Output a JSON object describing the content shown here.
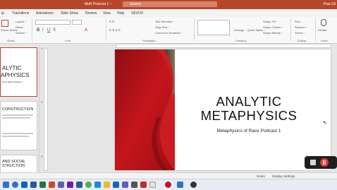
{
  "titlebar": {
    "doc_title": "MoR Podcast 1 ~",
    "search_placeholder": "Search",
    "user": "Paul Gil"
  },
  "tabs": [
    "ip",
    "Transitions",
    "Animations",
    "Slide Show",
    "Review",
    "View",
    "Help",
    "VEVOX"
  ],
  "ribbon": {
    "groups": [
      "Slides",
      "Font",
      "Paragraph",
      "Drawing",
      "Editing",
      "Voice"
    ],
    "slides_buttons": [
      "Reuse Slides",
      "Layout ~",
      "Reset",
      "Section ~"
    ],
    "paragraph_buttons": [
      "Text Direction ~",
      "Align Text ~",
      "Convert to SmartArt ~"
    ],
    "drawing_buttons": [
      "Arrange",
      "Quick Styles ~",
      "Shape Fill ~",
      "Shape Outline ~",
      "Shape Effects ~"
    ],
    "editing_buttons": [
      "Find",
      "Replace ~",
      "Select ~"
    ],
    "voice_buttons": [
      "Dictate"
    ]
  },
  "thumbnails": [
    {
      "num": "1",
      "lines": [
        "ALYTIC",
        "APHYSICS",
        "ics of Race Podcast 1"
      ]
    },
    {
      "num": "2",
      "lines": [
        "CONSTRUCTION"
      ]
    },
    {
      "num": "3",
      "lines": [
        "AND SOCIAL",
        "STRUCTION"
      ]
    }
  ],
  "slide": {
    "title_line1": "ANALYTIC",
    "title_line2": "METAPHYSICS",
    "subtitle": "Metaphysics of Race Podcast 1"
  },
  "status": {
    "notes": "Notes",
    "display_settings": "Display Settings"
  },
  "colors": {
    "accent": "#b7472a",
    "slide_red": "#c4161c"
  },
  "taskbar_icons": [
    "start-icon",
    "search-icon",
    "taskview-icon",
    "edge-icon",
    "outlook-icon",
    "word-icon",
    "excel-icon",
    "teams-icon",
    "onenote-icon",
    "chrome-icon",
    "explorer-icon",
    "store-icon",
    "acrobat-icon",
    "zoom-icon",
    "powerpoint-icon",
    "settings-icon",
    "obs-icon",
    "panopto-icon"
  ]
}
